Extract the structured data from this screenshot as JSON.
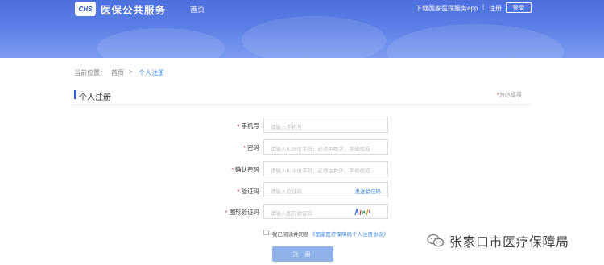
{
  "header": {
    "logo_text": "CHS",
    "site_title": "医保公共服务",
    "nav_home": "首页",
    "download_app": "下载国家医保服务app",
    "separator": "|",
    "register": "注册",
    "login": "登录"
  },
  "breadcrumb": {
    "prefix": "当前位置：",
    "home": "首页",
    "arrow": ">",
    "current": "个人注册"
  },
  "page": {
    "title": "个人注册",
    "required_note_star": "*",
    "required_note": "为必填项"
  },
  "form": {
    "fields": [
      {
        "label": "手机号",
        "placeholder": "请输入手机号"
      },
      {
        "label": "密码",
        "placeholder": "请输入8-16位字符，必须由数字、字母组成"
      },
      {
        "label": "确认密码",
        "placeholder": "请输入8-16位字符，必须由数字、字母组成"
      },
      {
        "label": "验证码",
        "placeholder": "请输入验证码",
        "action": "发送验证码"
      },
      {
        "label": "图形验证码",
        "placeholder": "请输入图形验证码"
      }
    ],
    "agree_text": "我已阅读并同意",
    "agree_link": "《国家医疗保障局个人注册协议》",
    "submit": "注 册"
  },
  "watermark": {
    "text": "张家口市医疗保障局"
  },
  "colors": {
    "header_blue": "#4d6fdc",
    "accent": "#3a87e0",
    "submit_bg": "#8fb2e8",
    "required_red": "#e04040"
  }
}
